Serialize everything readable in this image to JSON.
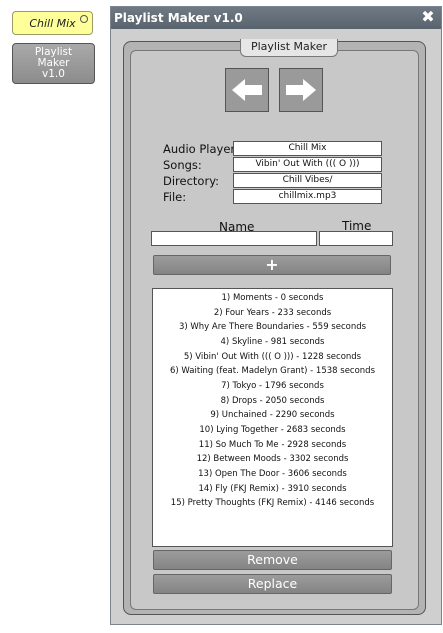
{
  "dock": {
    "chill_mix_label": "Chill Mix",
    "playlist_maker_label": "Playlist\nMaker\nv1.0"
  },
  "window": {
    "title": "Playlist Maker v1.0",
    "close_glyph": "✖",
    "panel_tab": "Playlist Maker"
  },
  "navigation": {
    "back_icon": "left-arrow-icon",
    "forward_icon": "right-arrow-icon"
  },
  "fields": {
    "audio_player": {
      "label": "Audio Player:",
      "value": "Chill Mix"
    },
    "songs": {
      "label": "Songs:",
      "value": "Vibin' Out With ((( O )))"
    },
    "directory": {
      "label": "Directory:",
      "value": "Chill Vibes/"
    },
    "file": {
      "label": "File:",
      "value": "chillmix.mp3"
    }
  },
  "add_form": {
    "name_header": "Name",
    "time_header": "Time",
    "name_value": "",
    "time_value": "",
    "add_label": "+"
  },
  "playlist": {
    "items": [
      "1) Moments - 0 seconds",
      "2) Four Years - 233 seconds",
      "3) Why Are There Boundaries - 559 seconds",
      "4) Skyline - 981 seconds",
      "5) Vibin' Out With ((( O ))) - 1228 seconds",
      "6) Waiting (feat. Madelyn Grant) - 1538 seconds",
      "7) Tokyo - 1796 seconds",
      "8) Drops - 2050 seconds",
      "9) Unchained - 2290 seconds",
      "10) Lying Together - 2683 seconds",
      "11) So Much To Me - 2928 seconds",
      "12) Between Moods - 3302 seconds",
      "13) Open The Door - 3606 seconds",
      "14) Fly (FKJ Remix) - 3910 seconds",
      "15) Pretty Thoughts (FKJ Remix) - 4146 seconds"
    ]
  },
  "actions": {
    "remove_label": "Remove",
    "replace_label": "Replace"
  }
}
